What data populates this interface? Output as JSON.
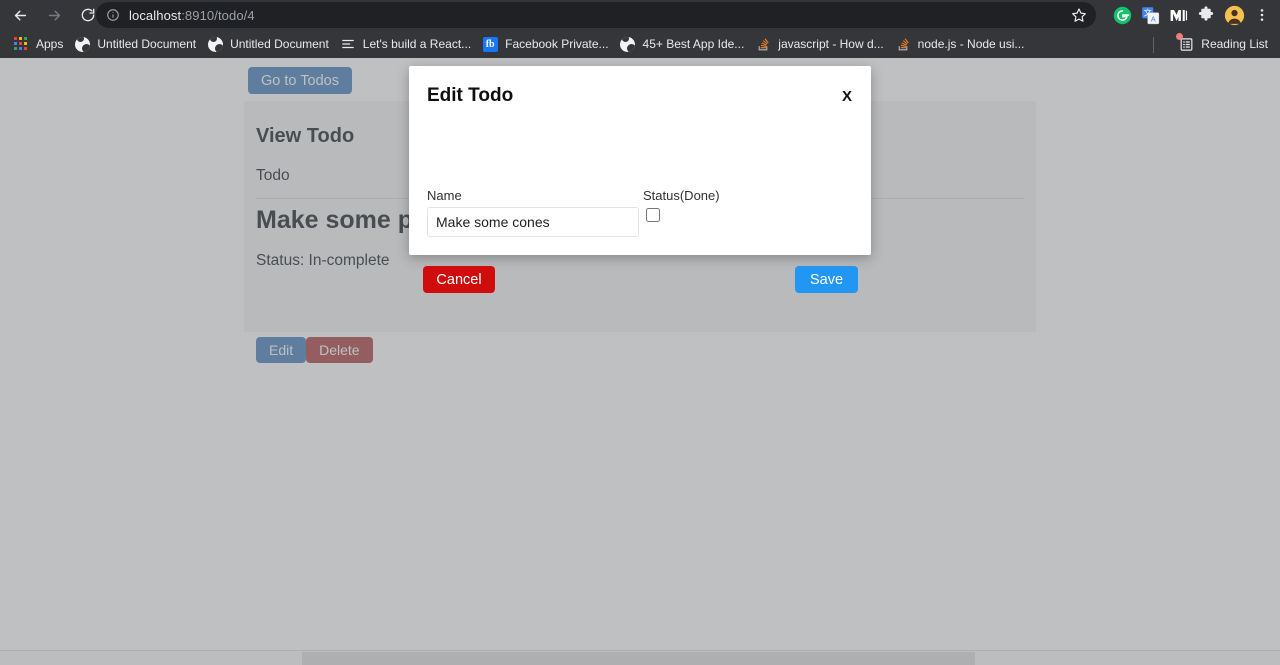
{
  "browser": {
    "nav": {
      "back_icon": "arrow-left-icon",
      "forward_icon": "arrow-right-icon",
      "reload_icon": "reload-icon"
    },
    "omnibox": {
      "info_icon": "info-circle-icon",
      "url_prefix": "localhost",
      "url_suffix": ":8910/todo/4",
      "full_url": "localhost:8910/todo/4",
      "star_icon": "star-icon"
    },
    "toolbar_icons": [
      {
        "name": "grammarly-icon",
        "glyph": "G",
        "color": "#15c26b"
      },
      {
        "name": "google-translate-icon",
        "glyph": "",
        "color": "#4285f4"
      },
      {
        "name": "medium-icon",
        "glyph": "M",
        "color": "#ffffff"
      },
      {
        "name": "extensions-puzzle-icon",
        "glyph": "",
        "color": "#e8eaed"
      },
      {
        "name": "profile-avatar",
        "glyph": "",
        "color": "#f2c14e"
      },
      {
        "name": "chrome-menu-icon",
        "glyph": "",
        "color": "#e8eaed"
      }
    ],
    "bookmarks": [
      {
        "label": "Apps",
        "icon": "apps-grid-icon"
      },
      {
        "label": "Untitled Document",
        "icon": "globe-icon"
      },
      {
        "label": "Untitled Document",
        "icon": "globe-icon"
      },
      {
        "label": "Let's build a React...",
        "icon": "list-icon"
      },
      {
        "label": "Facebook Private...",
        "icon": "facebook-icon"
      },
      {
        "label": "45+ Best App Ide...",
        "icon": "globe-icon"
      },
      {
        "label": "javascript - How d...",
        "icon": "stackoverflow-icon"
      },
      {
        "label": "node.js - Node usi...",
        "icon": "stackoverflow-icon"
      }
    ],
    "reading_list": {
      "label": "Reading List",
      "icon": "reading-list-icon",
      "has_badge": true
    }
  },
  "page": {
    "go_to_todos_label": "Go to Todos",
    "card": {
      "title": "View Todo",
      "field_label": "Todo",
      "todo_name": "Make some pasta",
      "status_text": "Status: In-complete",
      "edit_label": "Edit",
      "delete_label": "Delete"
    }
  },
  "modal": {
    "title": "Edit Todo",
    "close_label": "X",
    "name_field": {
      "label": "Name",
      "value": "Make some cones",
      "placeholder": "Name"
    },
    "status_field": {
      "label": "Status(Done)",
      "checked": false
    },
    "cancel_label": "Cancel",
    "save_label": "Save"
  },
  "colors": {
    "primary_blue": "#5b8ec4",
    "save_blue": "#2196f3",
    "cancel_red": "#cf0d0d",
    "delete_red": "#b5565a",
    "chrome_dark": "#35363a"
  }
}
